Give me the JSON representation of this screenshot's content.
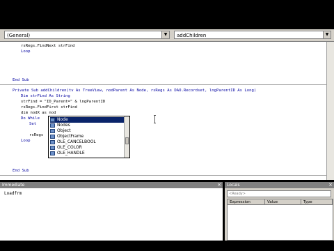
{
  "editor": {
    "object_combo": "(General)",
    "procedure_combo": "addChildren",
    "lines": [
      "rsRegs.FindNext strFind",
      "Loop",
      "End Sub",
      "Private Sub addChildren(tv As TreeView, nodParent As Node, rsRegs As DAO.Recordset, lngParentID As Long)",
      "Dim strFind As String",
      "strFind = \"ID_Parent=\" & lngParentID",
      "rsRegs.FindFirst strFind",
      "dim nodX as nod",
      "Do While",
      "Set",
      "rsRegs",
      "Loop",
      "End Sub"
    ]
  },
  "autocomplete": {
    "items": [
      "Node",
      "Nodes",
      "Object",
      "ObjectFrame",
      "OLE_CANCELBOOL",
      "OLE_COLOR",
      "OLE_HANDLE"
    ],
    "selected_index": 0
  },
  "immediate": {
    "title": "Immediate",
    "content": "Loadfrm"
  },
  "locals": {
    "title": "Locals",
    "status": "<Ready>",
    "columns": [
      "Expression",
      "Value",
      "Type"
    ]
  },
  "colors": {
    "keyword": "#0000a0",
    "selection": "#0a246a"
  }
}
